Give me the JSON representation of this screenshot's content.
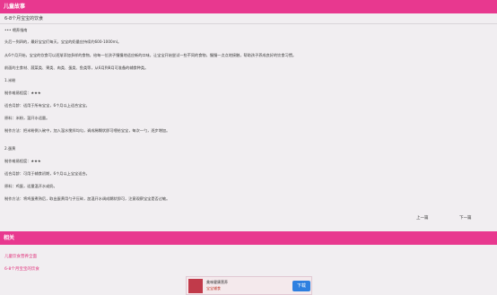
{
  "header": {
    "title": "儿童故事"
  },
  "article": {
    "title": "6-8个月宝宝的饮食",
    "paragraphs": [
      "••• 喂养指南",
      "头后一到四的，最好宝宝们每天，宝宝的奶量应持续约600-1000ml。",
      "从6个月开始，宝宝的饮食可以逐渐添加多样的食物，给每一位孩子慢慢地适应新的口味，让宝宝开始尝试一些不同的食物，慢慢一点点地接触，帮助孩子养成良好的饮食习惯。",
      "前面的主食材、蔬菜类、果类、肉类、蛋类、鱼类等，从6月到8月可准备的辅食种类。",
      "1.米粉",
      "制作难易程度：★★★",
      "适合月龄：适用于所有宝宝，6个月以上适合宝宝。",
      "原料：米粉，温开水适量。",
      "制作方法：把米粉倒入碗中，加入温水搅拌均匀，调成稀糊状即可喂给宝宝，每次一勺，逐步增加。",
      "2.蛋黄",
      "制作难易程度：★★★",
      "适合月龄：可用于辅食初期，6个月以上宝宝适合。",
      "原料：鸡蛋，适量温开水或奶。",
      "制作方法：将鸡蛋煮熟后，取出蛋黄用勺子压碎，加温开水调成糊状即可，注意观察宝宝是否过敏。"
    ]
  },
  "nav": {
    "prev_label": "上一篇",
    "next_label": "下一篇"
  },
  "footer": {
    "title": "相关",
    "related": [
      "儿童饮食营养全面",
      "6-8个月宝宝的饮食"
    ]
  },
  "ad": {
    "line1": "美味健康营养",
    "line2": "宝宝辅食",
    "button": "下载"
  }
}
